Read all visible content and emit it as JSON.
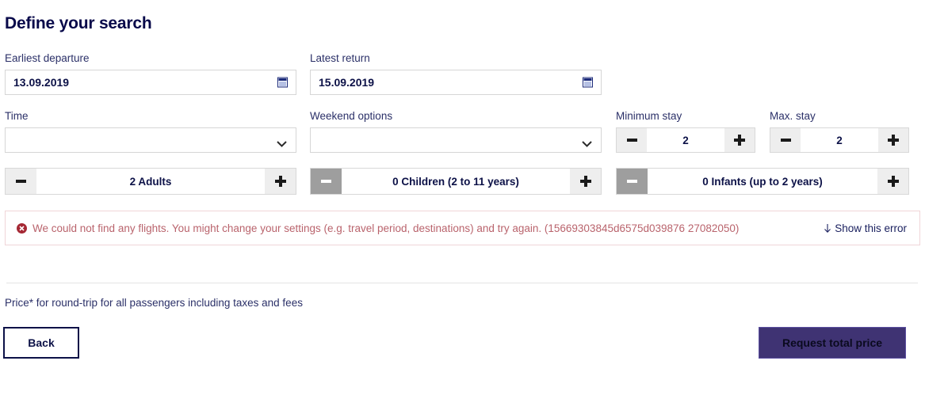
{
  "page": {
    "title": "Define your search"
  },
  "dates": {
    "earliest": {
      "label": "Earliest departure",
      "value": "13.09.2019",
      "icon": "calendar-icon"
    },
    "latest": {
      "label": "Latest return",
      "value": "15.09.2019",
      "icon": "calendar-icon"
    }
  },
  "selects": {
    "time": {
      "label": "Time",
      "value": "",
      "icon": "chevron-down-icon"
    },
    "weekend": {
      "label": "Weekend options",
      "value": "",
      "icon": "chevron-down-icon"
    }
  },
  "stay": {
    "minimum": {
      "label": "Minimum stay",
      "value": "2",
      "decrement": "−",
      "increment": "+"
    },
    "maximum": {
      "label": "Max. stay",
      "value": "2",
      "decrement": "−",
      "increment": "+"
    }
  },
  "passengers": [
    {
      "key": "adults",
      "value": "2 Adults",
      "decrement_disabled": false
    },
    {
      "key": "children",
      "value": "0 Children (2 to 11 years)",
      "decrement_disabled": true
    },
    {
      "key": "infants",
      "value": "0 Infants (up to 2 years)",
      "decrement_disabled": true
    }
  ],
  "error": {
    "icon": "error-circle-icon",
    "message": "We could not find any flights. You might change your settings (e.g. travel period, destinations) and try again. (15669303845d6575d039876 27082050)",
    "show_link": "Show this error",
    "show_link_icon": "arrow-down-icon",
    "text_color": "#b9636c",
    "border_color": "#f0d5d8"
  },
  "footer": {
    "price_note": "Price* for round-trip for all passengers including taxes and fees",
    "back_label": "Back",
    "request_label": "Request total price",
    "request_bg": "#3f3373"
  }
}
